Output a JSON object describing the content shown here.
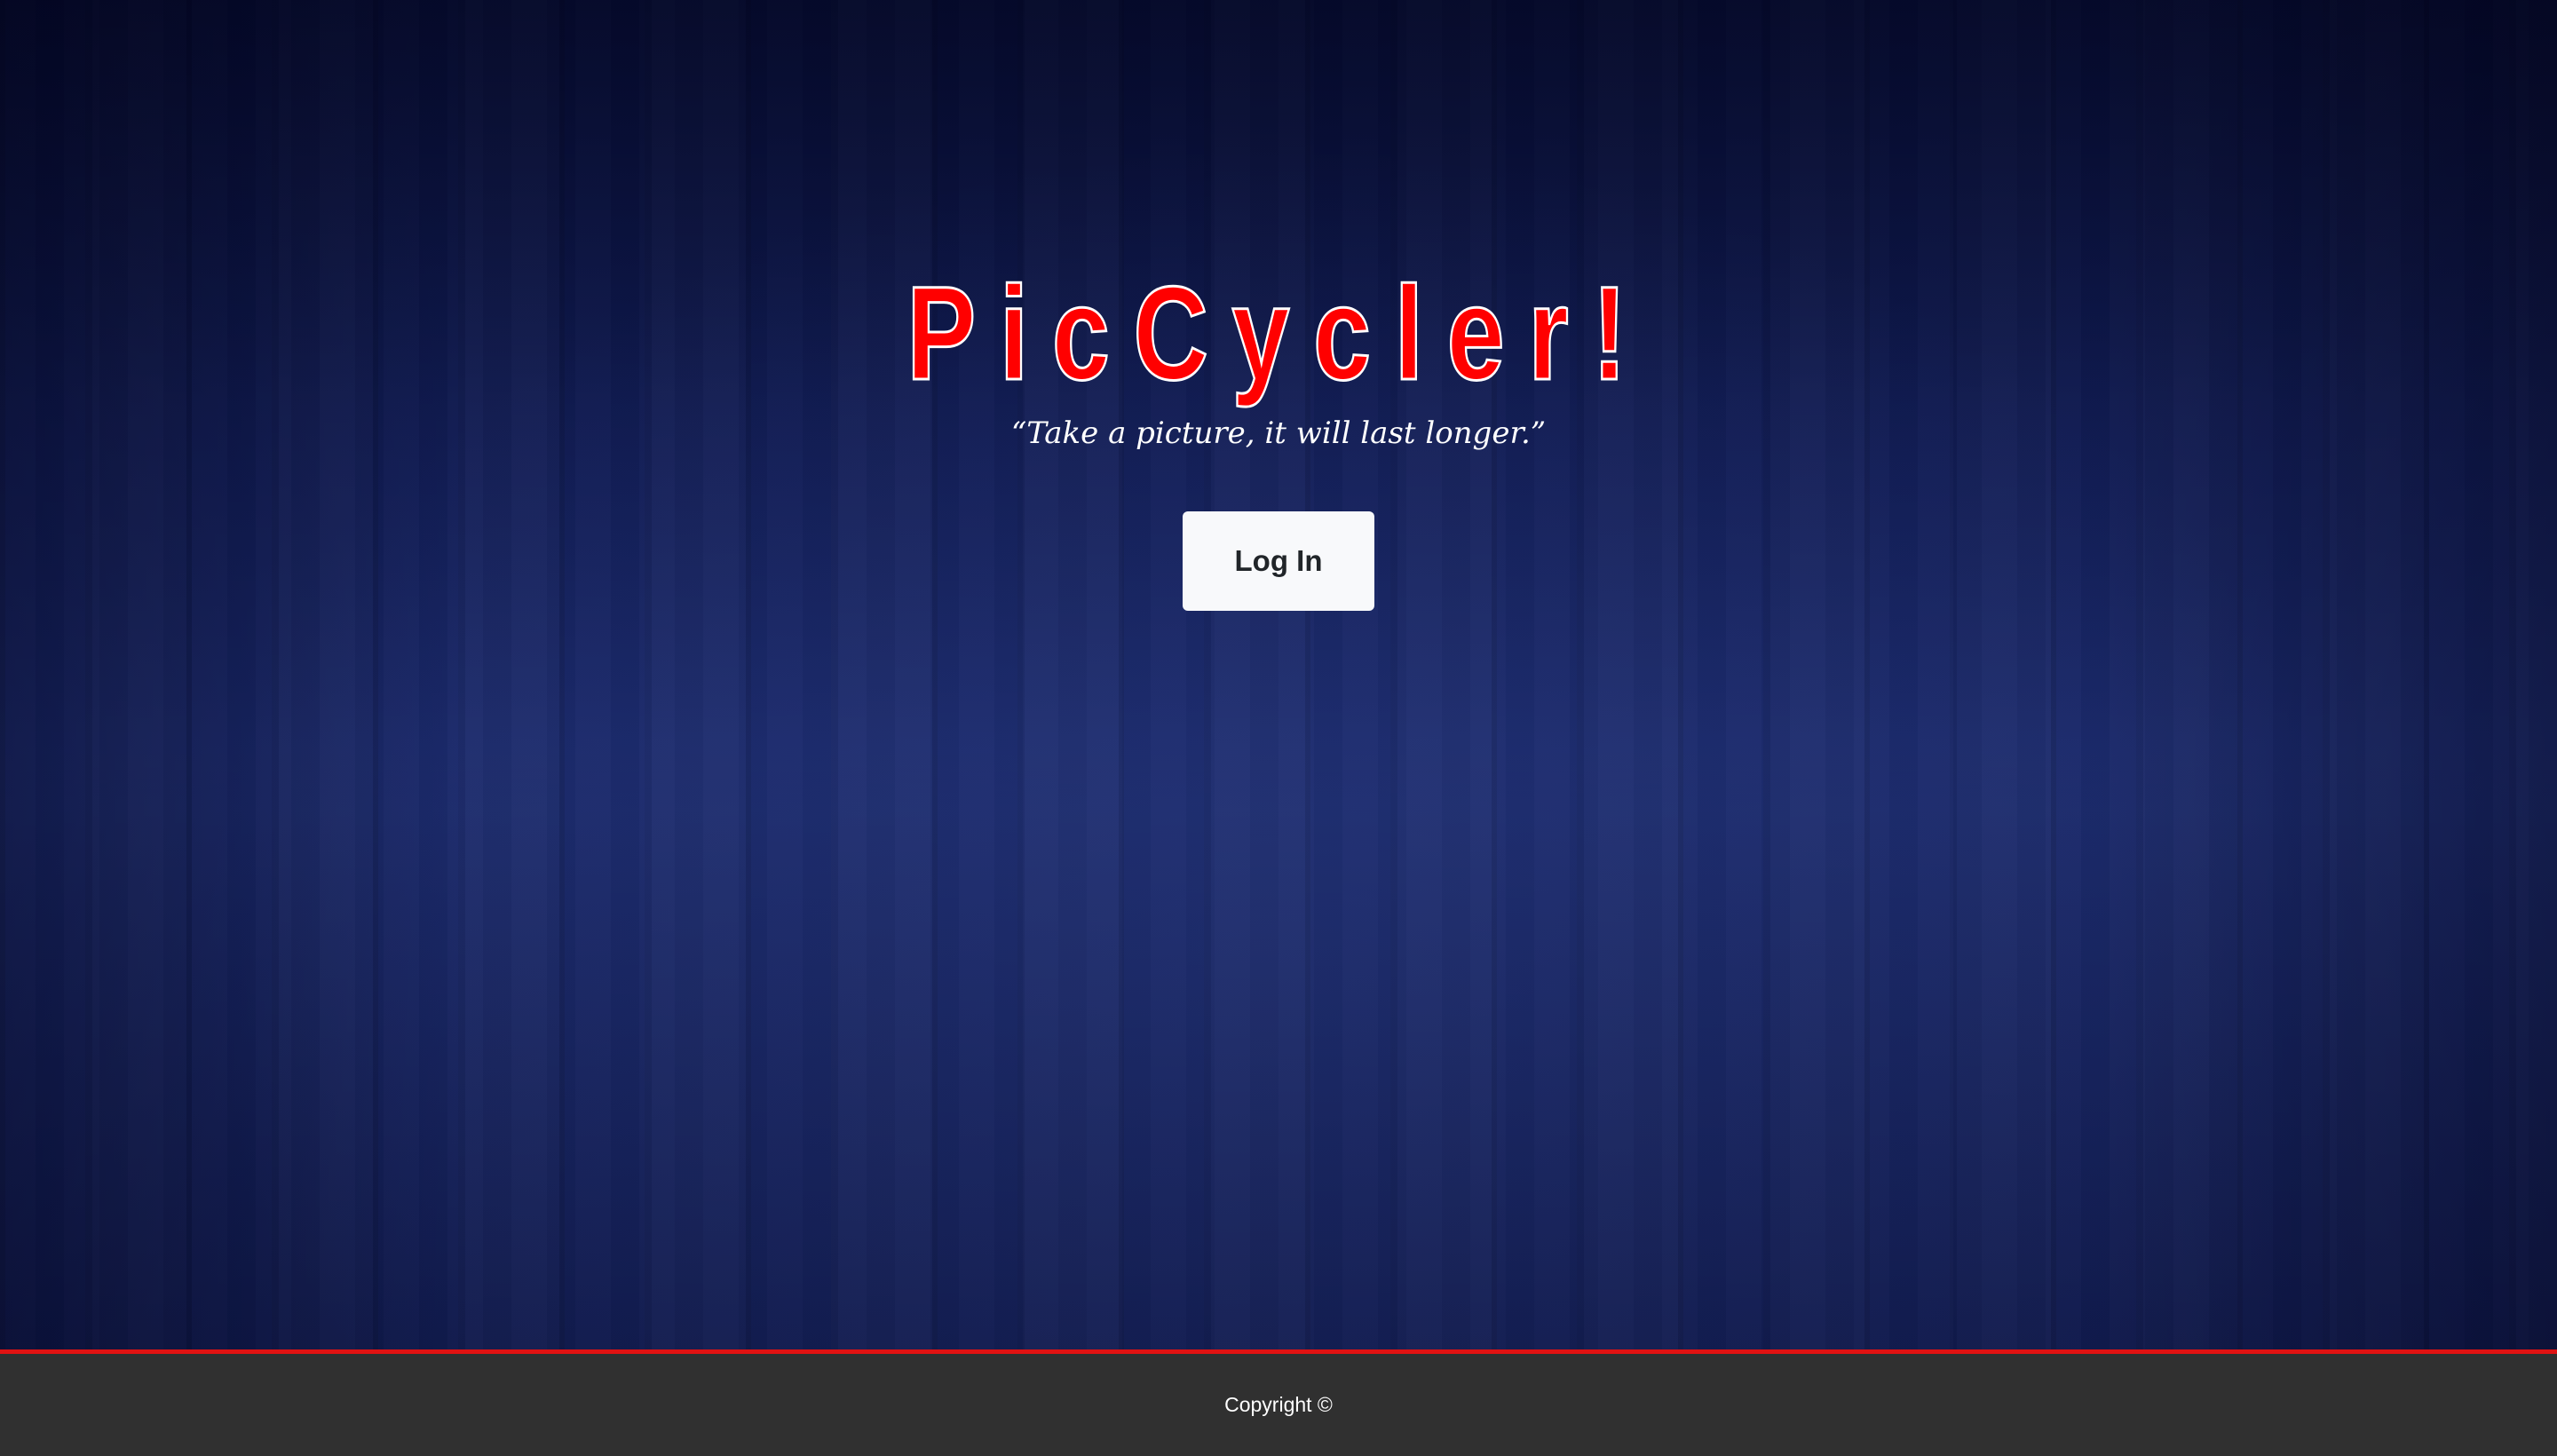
{
  "app": {
    "title": "PicCycler!",
    "tagline": "“Take a picture, it will last longer.”"
  },
  "actions": {
    "login_label": "Log In"
  },
  "footer": {
    "copyright": "Copyright ©"
  },
  "colors": {
    "title_fill": "#ff0000",
    "title_outline": "#ffffff",
    "background_navy": "#1b2a6c",
    "footer_bg": "#303030",
    "footer_accent": "#e01212",
    "button_bg": "#f8f9fb"
  }
}
